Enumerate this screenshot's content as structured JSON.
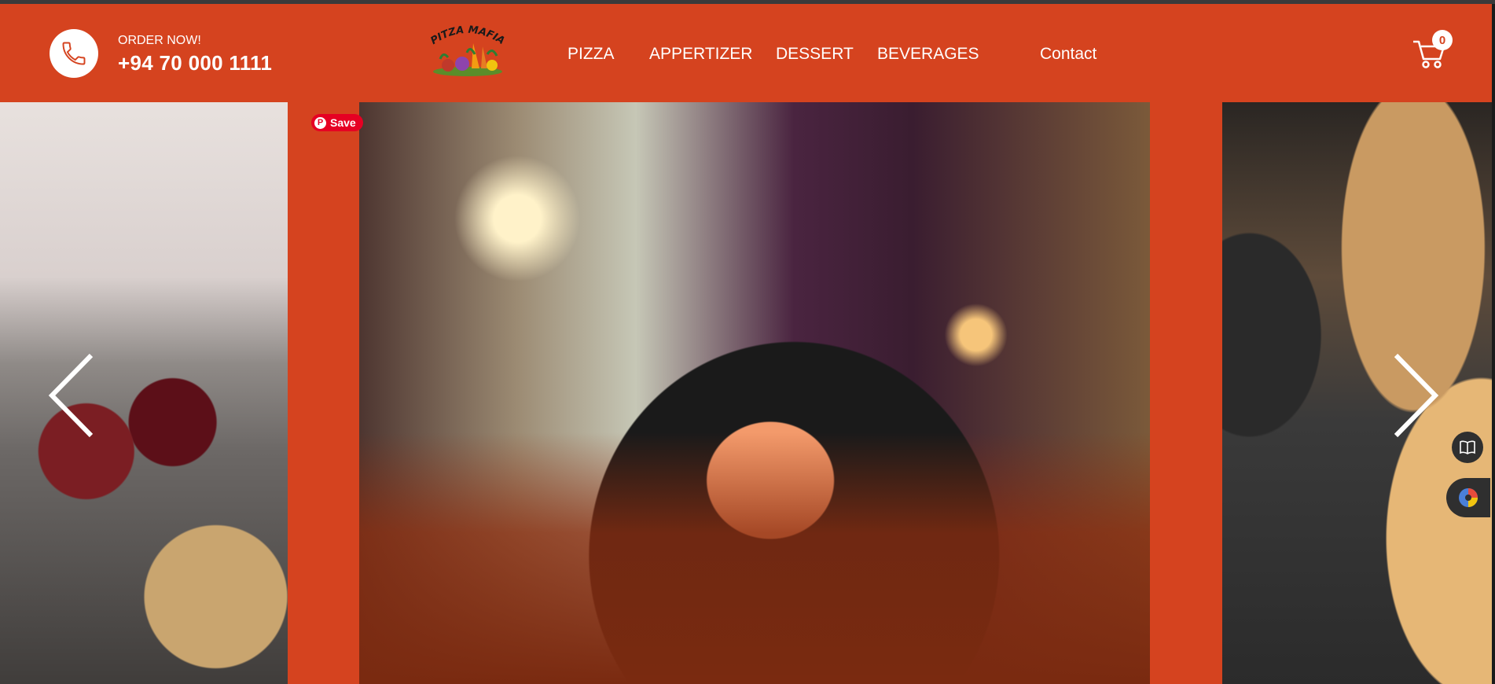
{
  "header": {
    "order_label": "ORDER NOW!",
    "phone_number": "+94 70 000 1111",
    "logo_text": "PITZA MAFIA",
    "nav": [
      {
        "label": "PIZZA"
      },
      {
        "label": "APPERTIZER"
      },
      {
        "label": "DESSERT"
      },
      {
        "label": "BEVERAGES"
      },
      {
        "label": "Contact"
      }
    ],
    "cart_count": "0"
  },
  "carousel": {
    "save_label": "Save",
    "prev_icon": "chevron-left-icon",
    "next_icon": "chevron-right-icon"
  },
  "colors": {
    "brand": "#d5431f",
    "pinterest": "#e60023",
    "white": "#ffffff"
  },
  "side_tools": [
    {
      "icon": "book-icon"
    },
    {
      "icon": "color-palette-icon"
    }
  ]
}
